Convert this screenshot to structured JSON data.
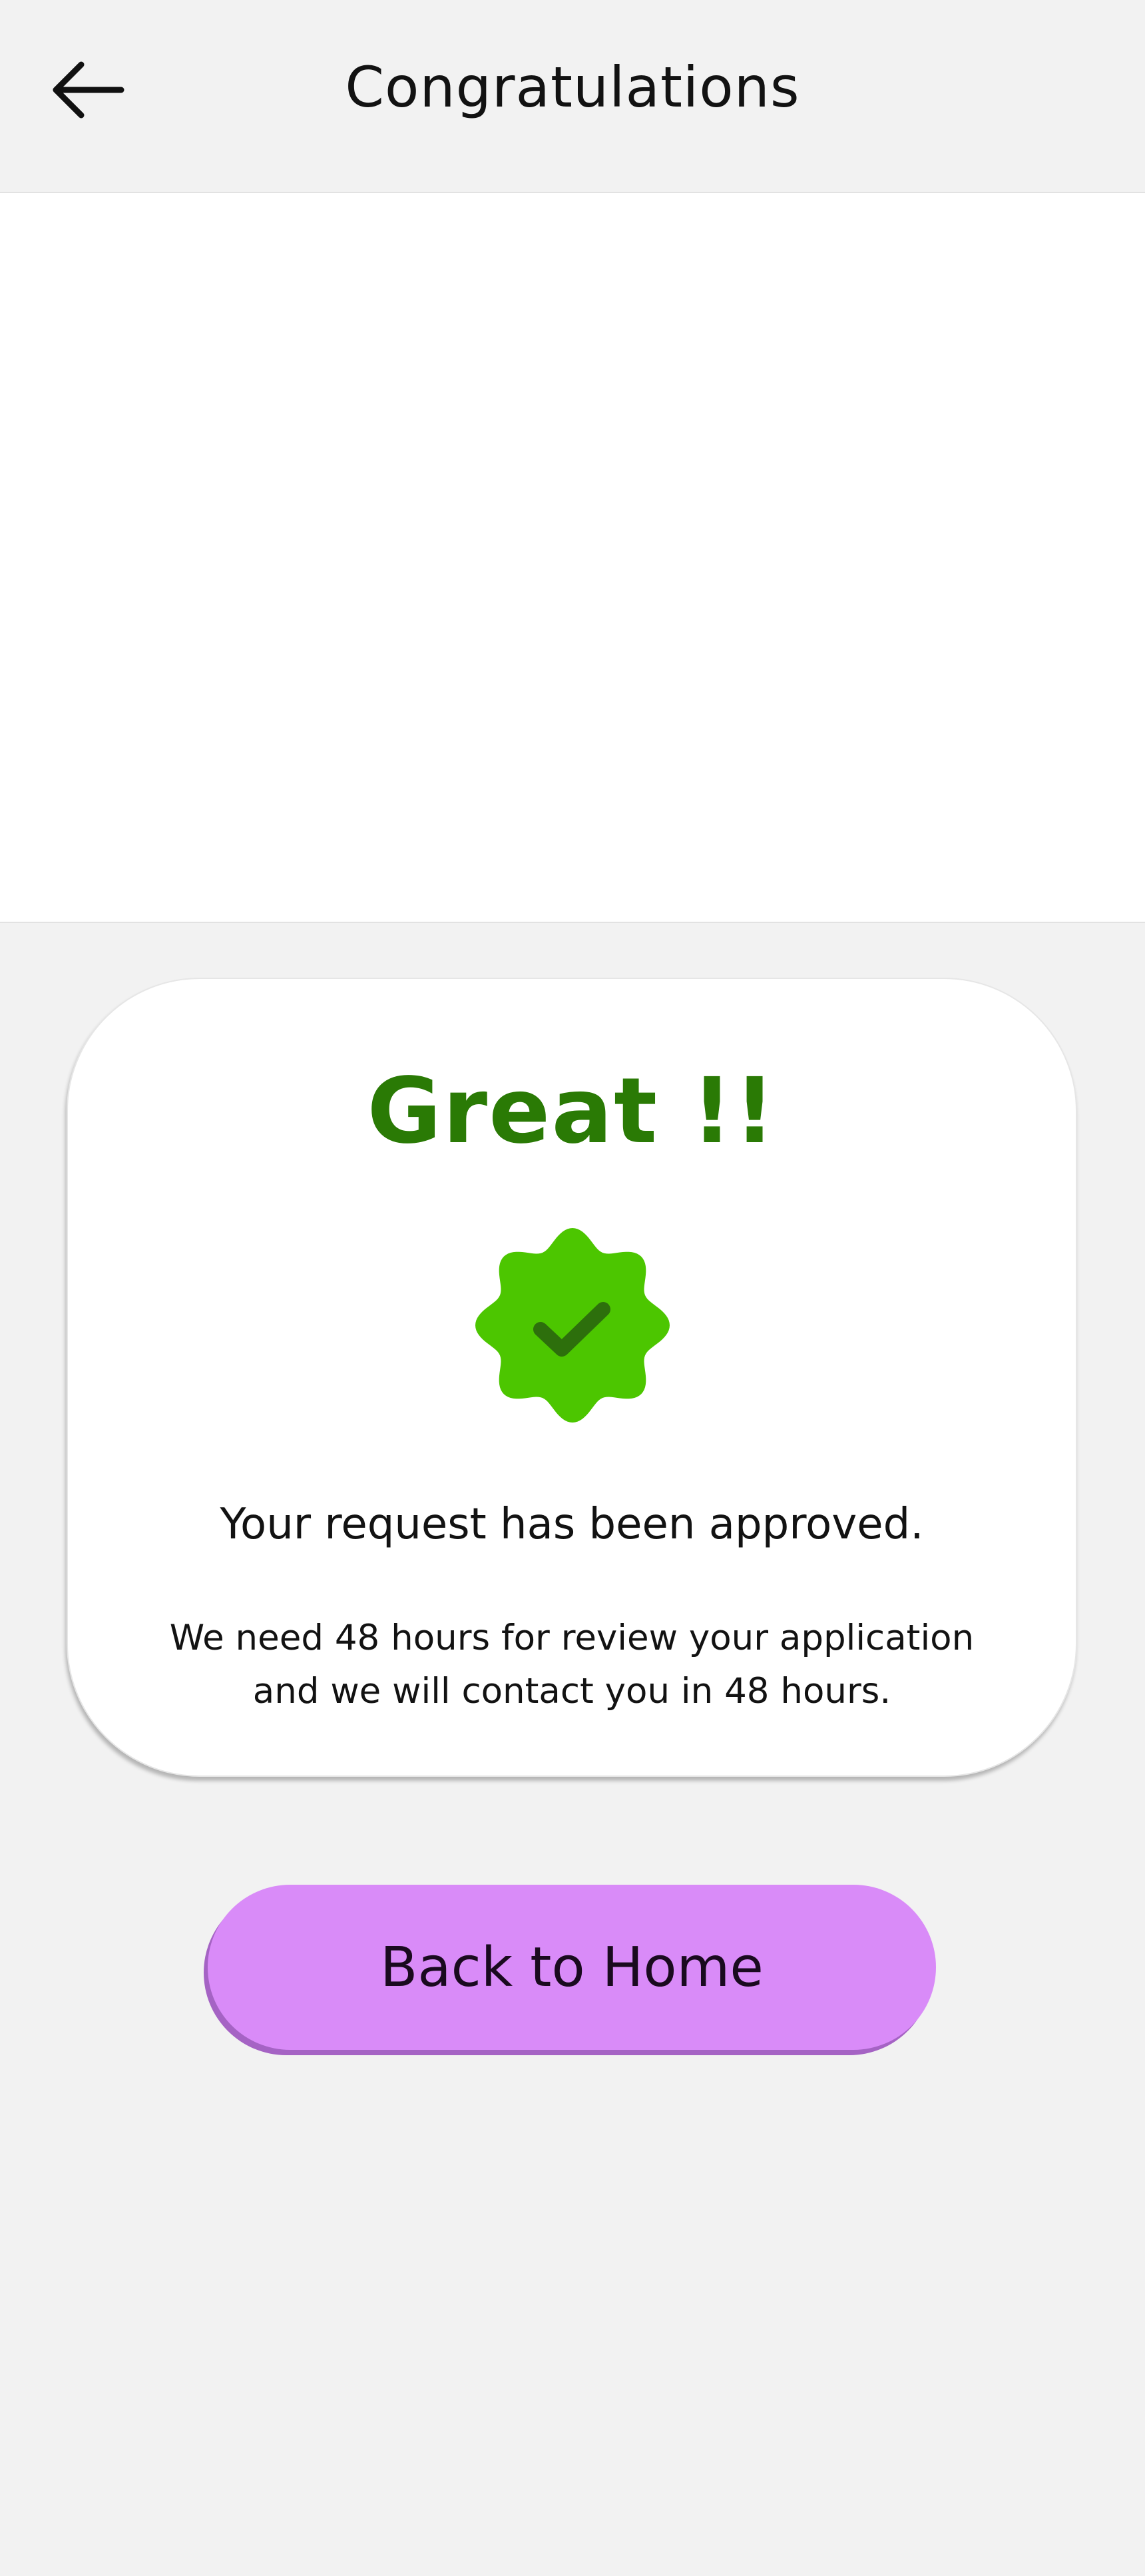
{
  "header": {
    "title": "Congratulations",
    "back_icon": "arrow-left-icon"
  },
  "card": {
    "heading": "Great !!",
    "badge_icon": "verified-badge-check-icon",
    "status": "Your request has been approved.",
    "message": "We need 48 hours for review your application and we will contact you in 48 hours."
  },
  "actions": {
    "home_label": "Back to Home"
  },
  "colors": {
    "background": "#f2f2f2",
    "heading_green": "#2a7a05",
    "badge_green": "#4cc600",
    "check_dark_green": "#2d6f0c",
    "button_purple": "#d98bf8",
    "button_shadow": "#a563c4"
  }
}
